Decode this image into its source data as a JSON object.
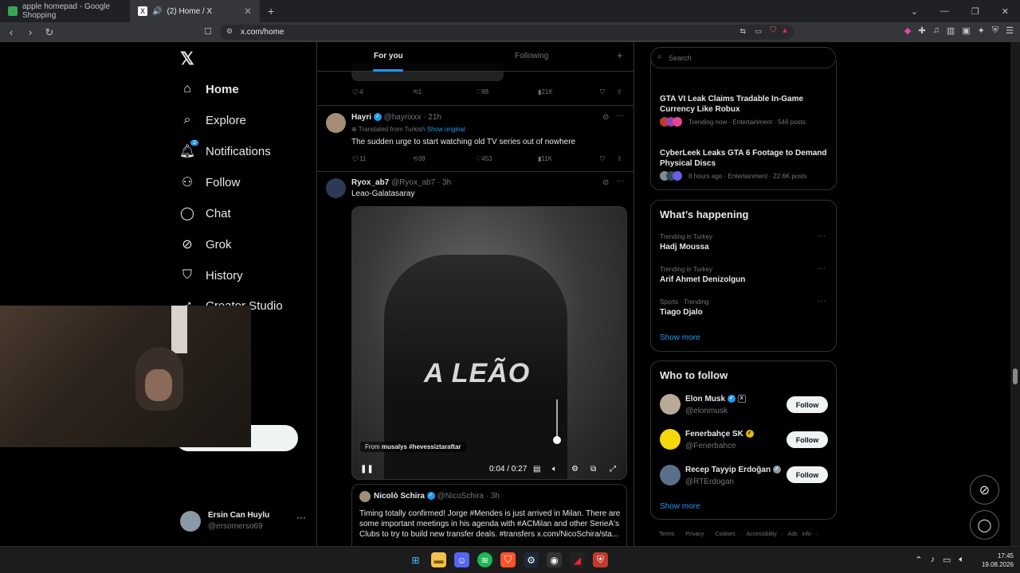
{
  "browser": {
    "tabs": [
      {
        "title": "apple homepad - Google Shopping",
        "active": false
      },
      {
        "title": "(2) Home / X",
        "active": true
      }
    ],
    "new_tab": "+",
    "url": "x.com/home"
  },
  "nav": {
    "logo": "𝕏",
    "items": [
      {
        "label": "Home"
      },
      {
        "label": "Explore"
      },
      {
        "label": "Notifications",
        "badge": "2"
      },
      {
        "label": "Follow"
      },
      {
        "label": "Chat"
      },
      {
        "label": "Grok"
      },
      {
        "label": "History"
      },
      {
        "label": "Creator Studio"
      }
    ],
    "account": {
      "name": "Ersin Can Huylu",
      "handle": "@ersomerso69",
      "more": "···"
    }
  },
  "timeline": {
    "tabs": [
      "For you",
      "Following"
    ],
    "plus": "+",
    "first_actions": {
      "replies": "4",
      "reposts": "1",
      "likes": "88",
      "views": "21K"
    },
    "tweet1": {
      "name": "Hayri",
      "handle": "@hayrixxx",
      "time": "· 21h",
      "translated": "Translated from Turkish",
      "show_original": "Show original",
      "text": "The sudden urge to start watching old TV series out of nowhere",
      "actions": {
        "replies": "11",
        "reposts": "39",
        "likes": "453",
        "views": "11K"
      }
    },
    "tweet2": {
      "name": "Ryox_ab7",
      "handle": "@Ryox_ab7",
      "time": "· 3h",
      "text": "Leao-Galatasaray",
      "video": {
        "jersey": "A LEÃO",
        "from_label": "From",
        "from_source": "musalys #hevessiztaraftar",
        "time": "0:04 / 0:27"
      },
      "quote": {
        "name": "Nicolò Schira",
        "handle": "@NicoSchira",
        "time": "· 3h",
        "text": "Timing totally confirmed! Jorge #Mendes is just arrived in Milan. There are some important meetings in his agenda with #ACMilan and other SerieA's Clubs to try to build new transfer deals. #transfers x.com/NicoSchira/sta..."
      }
    }
  },
  "sidebar": {
    "search_placeholder": "Search",
    "news": [
      {
        "title": "GTA VI Leak Claims Tradable In-Game Currency Like Robux",
        "meta": "Trending now · Entertainment · 546 posts"
      },
      {
        "title": "CyberLeek Leaks GTA 6 Footage to Demand Physical Discs",
        "meta": "8 hours ago · Entertainment · 22.6K posts"
      }
    ],
    "happening": {
      "title": "What’s happening",
      "trends": [
        {
          "context": "Trending in Turkey",
          "name": "Hadj Moussa"
        },
        {
          "context": "Trending in Turkey",
          "name": "Arif Ahmet Denizolgun"
        },
        {
          "context": "Sports · Trending",
          "name": "Tiago Djalo"
        }
      ],
      "show_more": "Show more"
    },
    "who_to_follow": {
      "title": "Who to follow",
      "accounts": [
        {
          "name": "Elon Musk",
          "handle": "@elonmusk",
          "button": "Follow"
        },
        {
          "name": "Fenerbahçe SK",
          "handle": "@Fenerbahce",
          "button": "Follow"
        },
        {
          "name": "Recep Tayyip Erdoğan",
          "handle": "@RTErdogan",
          "button": "Follow"
        }
      ],
      "show_more": "Show more"
    },
    "footer": "Terms · Privacy · Cookies · Accessibility · Ads info ·"
  },
  "taskbar": {
    "time": "17:45",
    "date": "19.08.2026"
  },
  "colors": {
    "accent": "#1d9bf0",
    "text": "#e7e9ea",
    "muted": "#71767b",
    "border": "#2f3336"
  }
}
